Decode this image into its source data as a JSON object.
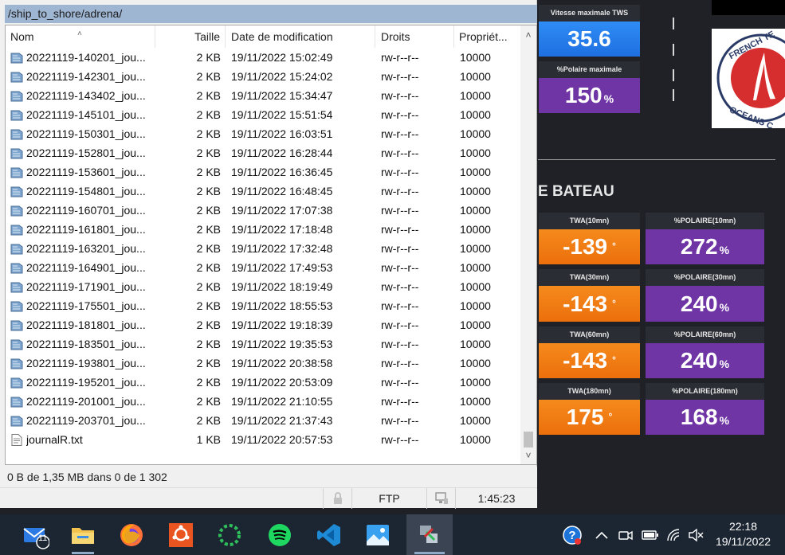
{
  "dashboard": {
    "tws": {
      "label": "Vitesse maximale TWS",
      "value": "35.6"
    },
    "polar_max": {
      "label": "%Polaire maximale",
      "value": "150",
      "unit": "%"
    },
    "section_title": "E BATEAU",
    "logo_text": "FRENCH TECH OCEANS",
    "tiles": [
      {
        "twa_label": "TWA(10mn)",
        "twa_value": "-139",
        "pol_label": "%POLAIRE(10mn)",
        "pol_value": "272"
      },
      {
        "twa_label": "TWA(30mn)",
        "twa_value": "-143",
        "pol_label": "%POLAIRE(30mn)",
        "pol_value": "240"
      },
      {
        "twa_label": "TWA(60mn)",
        "twa_value": "-143",
        "pol_label": "%POLAIRE(60mn)",
        "pol_value": "240"
      },
      {
        "twa_label": "TWA(180mn)",
        "twa_value": "175",
        "pol_label": "%POLAIRE(180mn)",
        "pol_value": "168"
      }
    ],
    "deg_symbol": "°",
    "pct_symbol": "%"
  },
  "window": {
    "path": "/ship_to_shore/adrena/",
    "columns": {
      "name": "Nom",
      "size": "Taille",
      "date": "Date de modification",
      "perms": "Droits",
      "owner": "Propriét..."
    },
    "files": [
      {
        "name": "20221119-140201_jou...",
        "size": "2 KB",
        "date": "19/11/2022 15:02:49",
        "perms": "rw-r--r--",
        "owner": "10000"
      },
      {
        "name": "20221119-142301_jou...",
        "size": "2 KB",
        "date": "19/11/2022 15:24:02",
        "perms": "rw-r--r--",
        "owner": "10000"
      },
      {
        "name": "20221119-143402_jou...",
        "size": "2 KB",
        "date": "19/11/2022 15:34:47",
        "perms": "rw-r--r--",
        "owner": "10000"
      },
      {
        "name": "20221119-145101_jou...",
        "size": "2 KB",
        "date": "19/11/2022 15:51:54",
        "perms": "rw-r--r--",
        "owner": "10000"
      },
      {
        "name": "20221119-150301_jou...",
        "size": "2 KB",
        "date": "19/11/2022 16:03:51",
        "perms": "rw-r--r--",
        "owner": "10000"
      },
      {
        "name": "20221119-152801_jou...",
        "size": "2 KB",
        "date": "19/11/2022 16:28:44",
        "perms": "rw-r--r--",
        "owner": "10000"
      },
      {
        "name": "20221119-153601_jou...",
        "size": "2 KB",
        "date": "19/11/2022 16:36:45",
        "perms": "rw-r--r--",
        "owner": "10000"
      },
      {
        "name": "20221119-154801_jou...",
        "size": "2 KB",
        "date": "19/11/2022 16:48:45",
        "perms": "rw-r--r--",
        "owner": "10000"
      },
      {
        "name": "20221119-160701_jou...",
        "size": "2 KB",
        "date": "19/11/2022 17:07:38",
        "perms": "rw-r--r--",
        "owner": "10000"
      },
      {
        "name": "20221119-161801_jou...",
        "size": "2 KB",
        "date": "19/11/2022 17:18:48",
        "perms": "rw-r--r--",
        "owner": "10000"
      },
      {
        "name": "20221119-163201_jou...",
        "size": "2 KB",
        "date": "19/11/2022 17:32:48",
        "perms": "rw-r--r--",
        "owner": "10000"
      },
      {
        "name": "20221119-164901_jou...",
        "size": "2 KB",
        "date": "19/11/2022 17:49:53",
        "perms": "rw-r--r--",
        "owner": "10000"
      },
      {
        "name": "20221119-171901_jou...",
        "size": "2 KB",
        "date": "19/11/2022 18:19:49",
        "perms": "rw-r--r--",
        "owner": "10000"
      },
      {
        "name": "20221119-175501_jou...",
        "size": "2 KB",
        "date": "19/11/2022 18:55:53",
        "perms": "rw-r--r--",
        "owner": "10000"
      },
      {
        "name": "20221119-181801_jou...",
        "size": "2 KB",
        "date": "19/11/2022 19:18:39",
        "perms": "rw-r--r--",
        "owner": "10000"
      },
      {
        "name": "20221119-183501_jou...",
        "size": "2 KB",
        "date": "19/11/2022 19:35:53",
        "perms": "rw-r--r--",
        "owner": "10000"
      },
      {
        "name": "20221119-193801_jou...",
        "size": "2 KB",
        "date": "19/11/2022 20:38:58",
        "perms": "rw-r--r--",
        "owner": "10000"
      },
      {
        "name": "20221119-195201_jou...",
        "size": "2 KB",
        "date": "19/11/2022 20:53:09",
        "perms": "rw-r--r--",
        "owner": "10000"
      },
      {
        "name": "20221119-201001_jou...",
        "size": "2 KB",
        "date": "19/11/2022 21:10:55",
        "perms": "rw-r--r--",
        "owner": "10000"
      },
      {
        "name": "20221119-203701_jou...",
        "size": "2 KB",
        "date": "19/11/2022 21:37:43",
        "perms": "rw-r--r--",
        "owner": "10000"
      },
      {
        "name": "journalR.txt",
        "size": "1 KB",
        "date": "19/11/2022 20:57:53",
        "perms": "rw-r--r--",
        "owner": "10000",
        "type": "txt"
      }
    ],
    "status_selection": "0 B de 1,35 MB dans 0 de 1 302",
    "status_protocol": "FTP",
    "status_elapsed": "1:45:23"
  },
  "taskbar": {
    "mail_badge": "11",
    "apps": [
      "mail-icon",
      "file-explorer-icon",
      "firefox-icon",
      "ubuntu-icon",
      "loading-app-icon",
      "spotify-icon",
      "vscode-icon",
      "photos-icon",
      "filezilla-icon"
    ],
    "clock_time": "22:18",
    "clock_date": "19/11/2022"
  },
  "colors": {
    "blue_tile": "#2f8cf5",
    "purple_tile": "#6f35a5",
    "orange_tile": "#f58a1c",
    "path_bar": "#9fb6d3",
    "taskbar": "#1c2633"
  }
}
